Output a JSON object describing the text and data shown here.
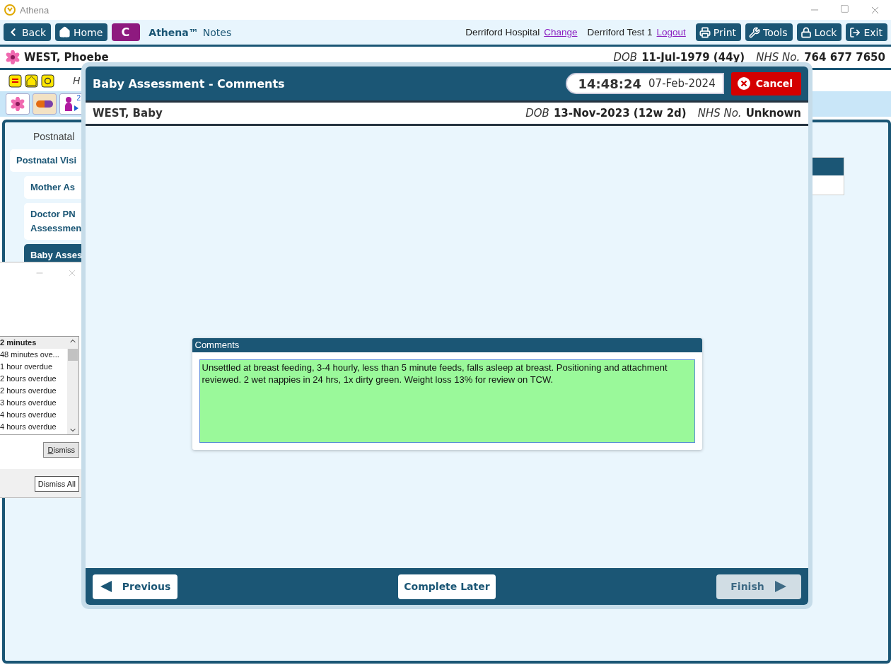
{
  "window": {
    "title": "Athena"
  },
  "toolbar": {
    "buttons": [
      {
        "kind": "back",
        "label": "Back"
      },
      {
        "kind": "home",
        "label": "Home"
      },
      {
        "kind": "letter",
        "label": "C"
      }
    ],
    "brand": "Athena™",
    "app": "Notes",
    "location": "Derriford Hospital",
    "location_link": "Change",
    "user": "Derriford Test 1",
    "user_link": "Logout",
    "actions": [
      {
        "kind": "print",
        "label": "Print"
      },
      {
        "kind": "tools",
        "label": "Tools"
      },
      {
        "kind": "lock",
        "label": "Lock"
      },
      {
        "kind": "exit",
        "label": "Exit"
      }
    ]
  },
  "patient": {
    "name": "WEST, Phoebe",
    "dob_label": "DOB",
    "dob": "11-Jul-1979 (44y)",
    "nhs_label": "NHS No.",
    "nhs": "764 677 7650"
  },
  "info_row": {
    "text": "H"
  },
  "quick_tabs": {
    "badge": "2"
  },
  "sidebar": {
    "heading": "Postnatal",
    "items": [
      {
        "label": "Postnatal Visi",
        "selected": false,
        "children": [
          {
            "label": "Mother As",
            "selected": false
          },
          {
            "label": "Doctor PN Assessmen",
            "selected": false
          },
          {
            "label": "Baby Asses",
            "selected": true
          }
        ]
      }
    ]
  },
  "reminders": {
    "items": [
      {
        "text": "2 minutes",
        "selected": true
      },
      {
        "text": "48 minutes ove...",
        "selected": false
      },
      {
        "text": "1 hour overdue",
        "selected": false
      },
      {
        "text": "2 hours overdue",
        "selected": false
      },
      {
        "text": "2 hours overdue",
        "selected": false
      },
      {
        "text": "3 hours overdue",
        "selected": false
      },
      {
        "text": "4 hours overdue",
        "selected": false
      },
      {
        "text": "4 hours overdue",
        "selected": false
      }
    ],
    "dismiss": "Dismiss",
    "dismiss_all": "Dismiss All"
  },
  "dialog": {
    "title": "Baby Assessment - Comments",
    "time": "14:48:24",
    "date": "07-Feb-2024",
    "cancel": "Cancel",
    "baby": {
      "name": "WEST, Baby",
      "dob_label": "DOB",
      "dob": "13-Nov-2023 (12w 2d)",
      "nhs_label": "NHS No.",
      "nhs": "Unknown"
    },
    "comments": {
      "label": "Comments",
      "value": "Unsettled at breast feeding, 3-4 hourly, less than 5 minute feeds, falls asleep at breast. Positioning and attachment reviewed. 2 wet nappies in 24 hrs, 1x dirty green. Weight loss 13% for review on TCW."
    },
    "footer": [
      {
        "kind": "previous",
        "label": "Previous",
        "disabled": false
      },
      {
        "kind": "later",
        "label": "Complete Later",
        "disabled": false
      },
      {
        "kind": "finish",
        "label": "Finish",
        "disabled": true
      }
    ]
  }
}
